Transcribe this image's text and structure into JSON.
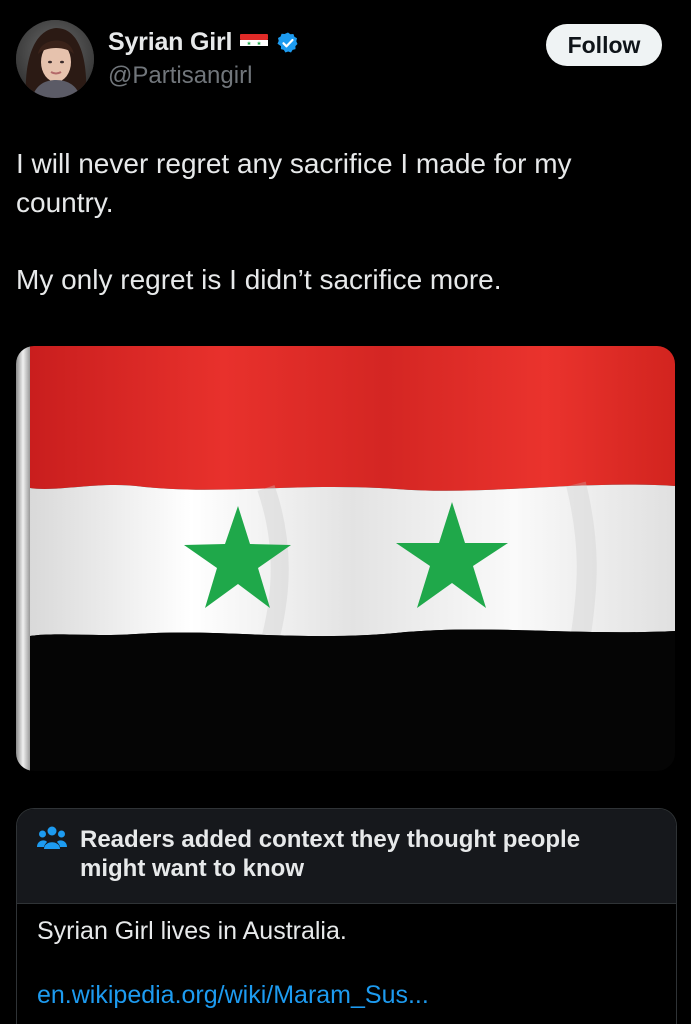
{
  "author": {
    "display_name": "Syrian Girl",
    "handle": "@Partisangirl",
    "flag_icon": "syria-flag-emoji",
    "verified_icon": "verified-badge-icon",
    "verified_color": "#1d9bf0"
  },
  "header": {
    "follow_label": "Follow"
  },
  "tweet": {
    "paragraphs": [
      "I will never regret any sacrifice I made for my country.",
      "My only regret is I didn’t sacrifice more."
    ]
  },
  "media": {
    "subject": "Syrian flag",
    "colors": {
      "red": "#e02a27",
      "white": "#f4f4f4",
      "black": "#000000",
      "star": "#1fa84a"
    }
  },
  "community_note": {
    "icon": "people-icon",
    "title": "Readers added context they thought people might want to know",
    "body": "Syrian Girl lives in Australia.",
    "link_text": "en.wikipedia.org/wiki/Maram_Sus..."
  }
}
